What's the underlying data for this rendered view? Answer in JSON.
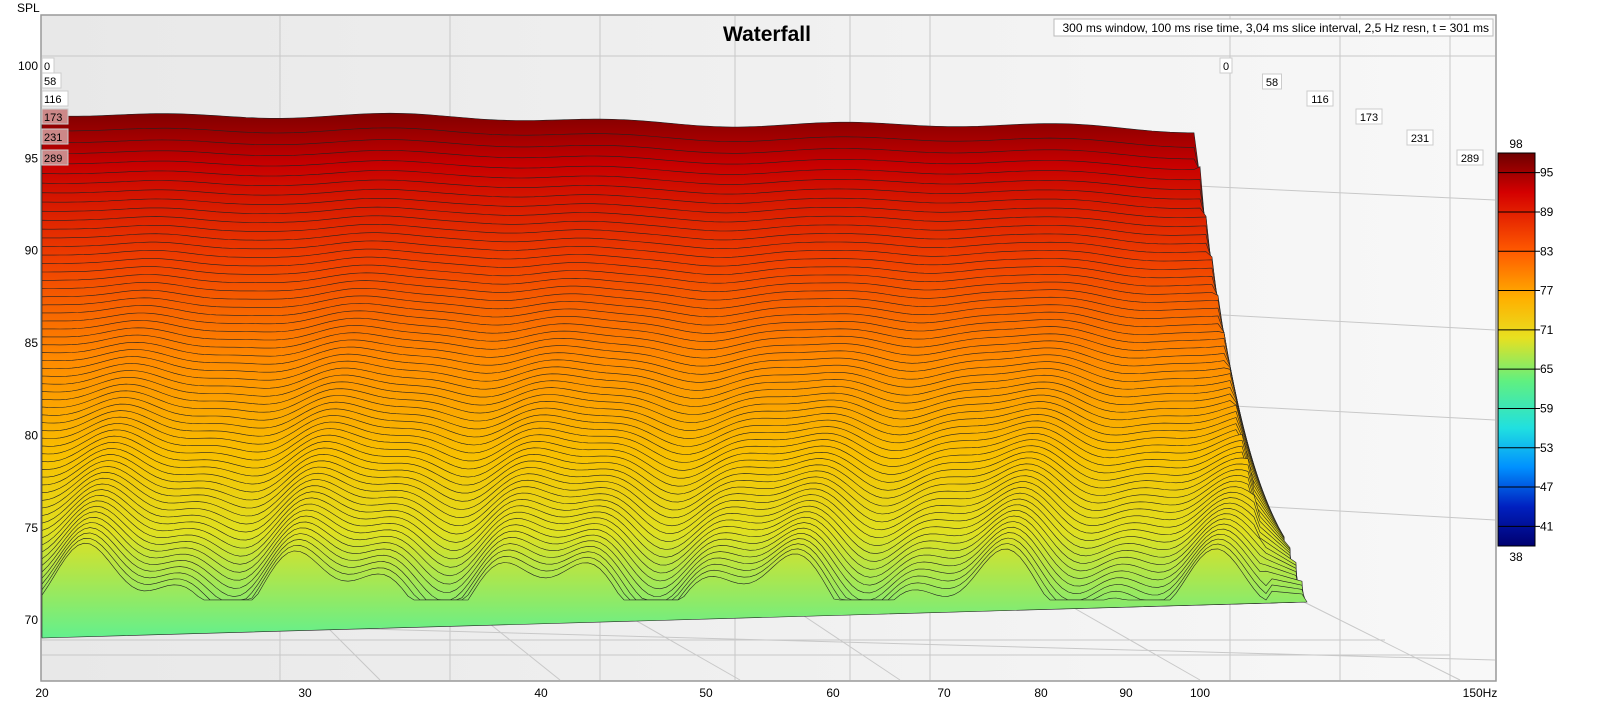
{
  "chart_data": {
    "type": "waterfall",
    "title": "Waterfall",
    "subtitle": "300 ms window, 100 ms rise time, 3,04 ms slice interval, 2,5 Hz resn, t = 301 ms",
    "ylabel": "SPL",
    "xlabel_unit": "Hz",
    "y_ticks": [
      "100",
      "95",
      "90",
      "85",
      "80",
      "75",
      "70"
    ],
    "ylim": [
      67,
      102
    ],
    "x_ticks": [
      "20",
      "30",
      "40",
      "50",
      "60",
      "70",
      "80",
      "90",
      "100",
      "150Hz"
    ],
    "xlim": [
      20,
      150
    ],
    "slice_times_ms": [
      "0",
      "58",
      "116",
      "173",
      "231",
      "289"
    ],
    "colorbar": {
      "max": "98",
      "min": "38",
      "ticks": [
        "95",
        "89",
        "83",
        "77",
        "71",
        "65",
        "59",
        "53",
        "47",
        "41"
      ],
      "colors": [
        "#6e0000",
        "#d40000",
        "#ff5a00",
        "#ffb000",
        "#e8e020",
        "#60f080",
        "#20e0e0",
        "#0090ff",
        "#0020c0",
        "#000070"
      ]
    },
    "series_summary": {
      "first_slice_level_db": 97.5,
      "last_slice_level_db": 72,
      "slice_count": 96
    }
  }
}
